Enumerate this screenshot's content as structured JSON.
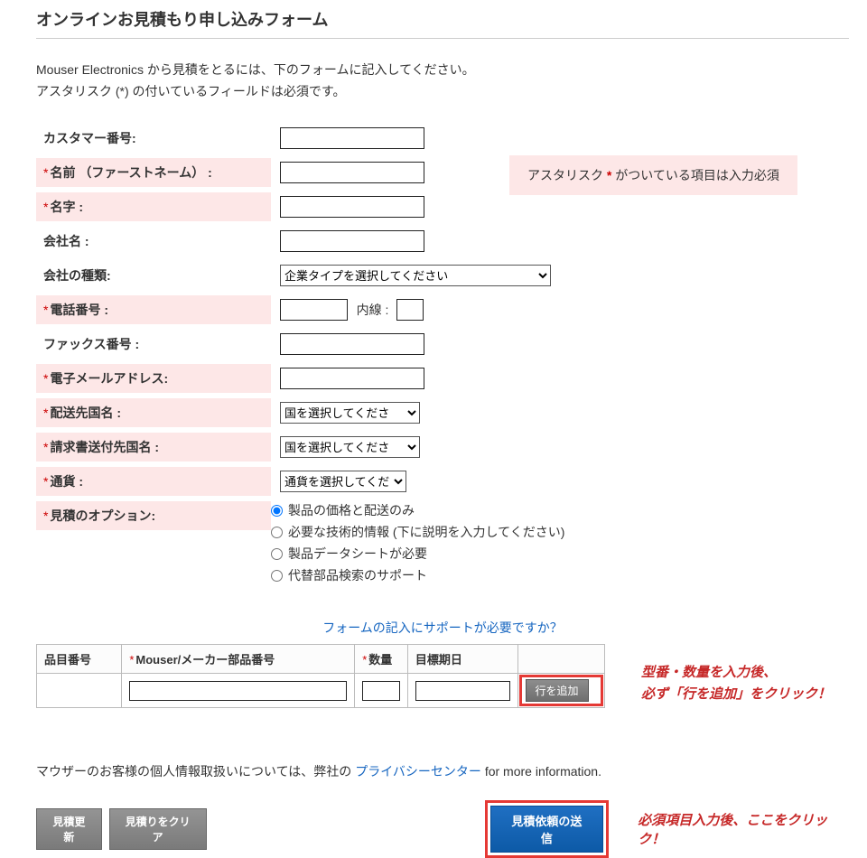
{
  "page": {
    "title": "オンラインお見積もり申し込みフォーム",
    "intro1": "Mouser Electronics から見積をとるには、下のフォームに記入してください。",
    "intro2": "アスタリスク (*) の付いているフィールドは必須です。"
  },
  "noteBox": {
    "pre": "アスタリスク ",
    "star": "*",
    "post": " がついている項目は入力必須"
  },
  "labels": {
    "customerNo": "カスタマー番号:",
    "firstName": "名前 （ファーストネーム） :",
    "lastName": "名字 :",
    "company": "会社名 :",
    "companyType": "会社の種類:",
    "phone": "電話番号 :",
    "ext": "内線 :",
    "fax": "ファックス番号 :",
    "email": "電子メールアドレス:",
    "shipCountry": "配送先国名 :",
    "billCountry": "請求書送付先国名 :",
    "currency": "通貨 :",
    "quoteOption": "見積のオプション:"
  },
  "selects": {
    "companyType": "企業タイプを選択してください",
    "shipCountry": "国を選択してくださ",
    "billCountry": "国を選択してくださ",
    "currency": "通貨を選択してくだ"
  },
  "radios": {
    "opt1": "製品の価格と配送のみ",
    "opt2": "必要な技術的情報 (下に説明を入力してください)",
    "opt3": "製品データシートが必要",
    "opt4": "代替部品検索のサポート"
  },
  "supportLink": "フォームの記入にサポートが必要ですか？",
  "table": {
    "h_itemno": "品目番号",
    "h_part": "Mouser/メーカー部品番号",
    "h_qty": "数量",
    "h_date": "目標期日",
    "addRow": "行を追加"
  },
  "sideNote": {
    "l1": "型番・数量を入力後、",
    "l2": "必ず「行を追加」をクリック！"
  },
  "privacy": {
    "pre": "マウザーのお客様の個人情報取扱いについては、弊社の ",
    "link": "プライバシーセンター",
    "post": " for more information."
  },
  "buttons": {
    "update": "見積更新",
    "clear": "見積りをクリア",
    "submit": "見積依頼の送信"
  },
  "submitNote": "必須項目入力後、ここをクリック！"
}
